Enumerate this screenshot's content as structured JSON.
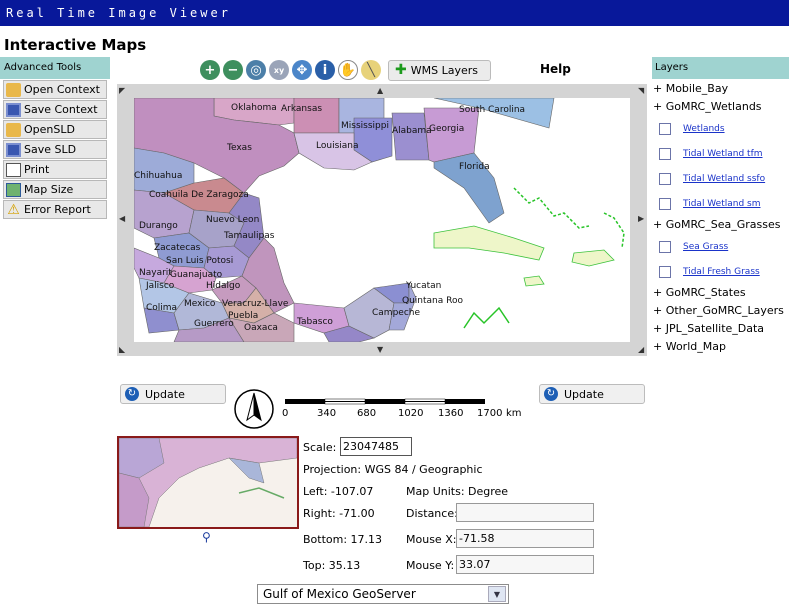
{
  "app": {
    "window_title": "Real Time Image Viewer",
    "page_title": "Interactive Maps"
  },
  "left_panel": {
    "heading": "Advanced Tools",
    "tools": [
      {
        "label": "Open Context",
        "icon": "folder-icon"
      },
      {
        "label": "Save Context",
        "icon": "save-icon"
      },
      {
        "label": "OpenSLD",
        "icon": "folder-icon"
      },
      {
        "label": "Save SLD",
        "icon": "save-icon"
      },
      {
        "label": "Print",
        "icon": "printer-icon"
      },
      {
        "label": "Map Size",
        "icon": "map-size-icon"
      },
      {
        "label": "Error Report",
        "icon": "warning-icon"
      }
    ]
  },
  "toolbar": {
    "icons": [
      "zoom-in-icon",
      "zoom-out-icon",
      "zoom-full-extent-icon",
      "zoom-to-coordinates-icon",
      "pan-icon",
      "identify-icon",
      "hand-drag-icon",
      "measure-ruler-icon"
    ],
    "wms_label": "WMS Layers",
    "help_label": "Help"
  },
  "map": {
    "labels": [
      "Oklahoma",
      "Arkansas",
      "South Carolina",
      "Mississippi",
      "Alabama",
      "Georgia",
      "Texas",
      "Louisiana",
      "Florida",
      "Chihuahua",
      "Coahuila De Zaragoza",
      "Nuevo Leon",
      "Durango",
      "Tamaulipas",
      "Zacatecas",
      "San Luis Potosi",
      "Nayarit",
      "Guanajuato",
      "Jalisco",
      "Hidalgo",
      "Colima",
      "Mexico",
      "Veracruz-Llave",
      "Yucatan",
      "Quintana Roo",
      "Campeche",
      "Puebla",
      "Tabasco",
      "Guerrero",
      "Oaxaca"
    ]
  },
  "layers": {
    "heading": "Layers",
    "items": [
      {
        "type": "group",
        "label": "+ Mobile_Bay"
      },
      {
        "type": "group",
        "label": "+ GoMRC_Wetlands"
      },
      {
        "type": "layer",
        "label": "Wetlands"
      },
      {
        "type": "layer",
        "label": "Tidal Wetland tfm"
      },
      {
        "type": "layer",
        "label": "Tidal Wetland ssfo"
      },
      {
        "type": "layer",
        "label": "Tidal Wetland sm"
      },
      {
        "type": "group",
        "label": "+ GoMRC_Sea_Grasses"
      },
      {
        "type": "layer",
        "label": "Sea Grass"
      },
      {
        "type": "layer",
        "label": "Tidal Fresh Grass"
      },
      {
        "type": "group",
        "label": "+ GoMRC_States"
      },
      {
        "type": "group",
        "label": "+ Other_GoMRC_Layers"
      },
      {
        "type": "group",
        "label": "+ JPL_Satellite_Data"
      },
      {
        "type": "group",
        "label": "+ World_Map"
      }
    ]
  },
  "update_label": "Update",
  "scalebar": {
    "ticks": [
      "0",
      "340",
      "680",
      "1020",
      "1360",
      "1700"
    ],
    "unit": "km"
  },
  "info": {
    "scale_label": "Scale:",
    "scale_value": "23047485",
    "projection": "Projection: WGS 84 / Geographic",
    "left": "Left: -107.07",
    "right": "Right: -71.00",
    "bottom": "Bottom: 17.13",
    "top": "Top: 35.13",
    "map_units": "Map Units: Degree",
    "distance_label": "Distance:",
    "distance_value": "",
    "mouse_x_label": "Mouse X:",
    "mouse_x_value": "-71.58",
    "mouse_y_label": "Mouse Y:",
    "mouse_y_value": "33.07"
  },
  "server_select": {
    "selected": "Gulf of Mexico GeoServer"
  }
}
